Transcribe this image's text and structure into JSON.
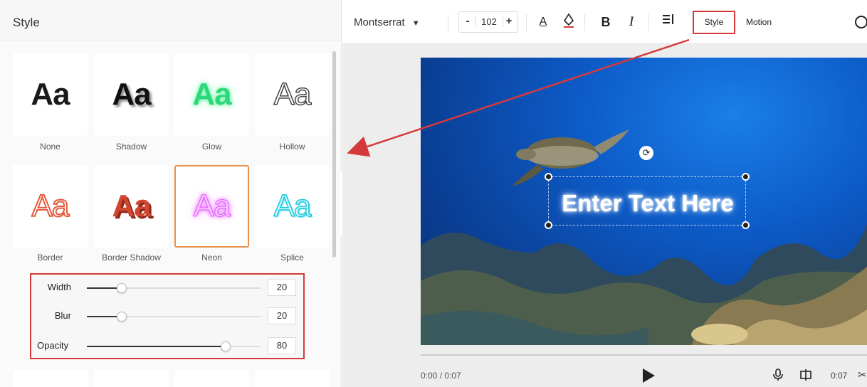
{
  "panel": {
    "title": "Style",
    "cards": [
      {
        "label": "None",
        "preview": "Aa"
      },
      {
        "label": "Shadow",
        "preview": "Aa"
      },
      {
        "label": "Glow",
        "preview": "Aa"
      },
      {
        "label": "Hollow",
        "preview": "Aa"
      },
      {
        "label": "Border",
        "preview": "Aa"
      },
      {
        "label": "Border Shadow",
        "preview": "Aa"
      },
      {
        "label": "Neon",
        "preview": "Aa",
        "selected": true
      },
      {
        "label": "Splice",
        "preview": "Aa"
      }
    ],
    "sliders": [
      {
        "label": "Width",
        "value": "20",
        "level": 0.2
      },
      {
        "label": "Blur",
        "value": "20",
        "level": 0.2
      },
      {
        "label": "Opacity",
        "value": "80",
        "level": 0.8
      }
    ]
  },
  "toolbar": {
    "font": "Montserrat",
    "font_size": "102",
    "minus": "-",
    "plus": "+",
    "style_label": "Style",
    "motion_label": "Motion",
    "bold": "B",
    "italic": "I",
    "text_color": "A"
  },
  "canvas": {
    "text": "Enter Text Here"
  },
  "player": {
    "time": "0:00 / 0:07",
    "end_time": "0:07"
  },
  "colors": {
    "accent_highlight": "#d53a3a",
    "selected_card": "#e9914c"
  }
}
